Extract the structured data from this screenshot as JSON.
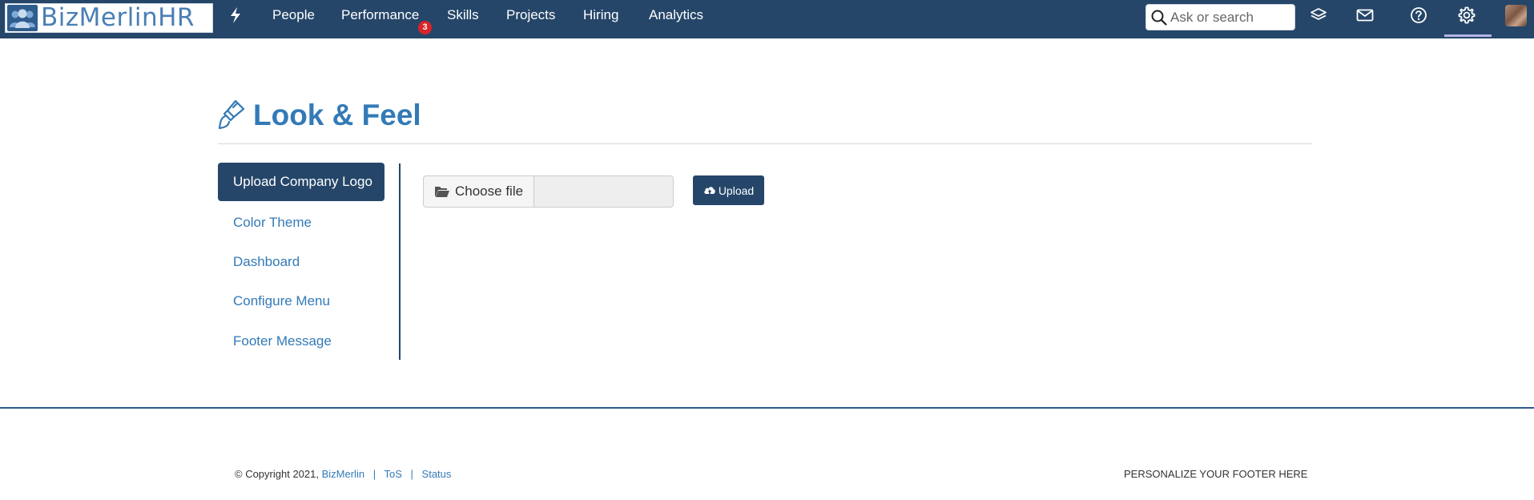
{
  "navbar": {
    "brand": "BizMerlinHR",
    "items": [
      {
        "label": "People"
      },
      {
        "label": "Performance"
      },
      {
        "label": "Skills"
      },
      {
        "label": "Projects"
      },
      {
        "label": "Hiring"
      },
      {
        "label": "Analytics"
      }
    ],
    "performance_badge": "3",
    "search_placeholder": "Ask or search",
    "icons": [
      "bolt-icon",
      "layers-icon",
      "mail-icon",
      "help-icon",
      "gear-icon"
    ]
  },
  "page": {
    "title": "Look & Feel",
    "title_icon": "paintbrush-icon"
  },
  "sidebar": {
    "active": "Upload Company Logo",
    "items": [
      {
        "label": "Color Theme"
      },
      {
        "label": "Dashboard"
      },
      {
        "label": "Configure Menu"
      },
      {
        "label": "Footer Message"
      }
    ]
  },
  "upload": {
    "choose_label": "Choose file",
    "file_value": "",
    "upload_label": "Upload"
  },
  "footer": {
    "copyright": "© Copyright 2021,",
    "brand_link": "BizMerlin",
    "sep": "|",
    "tos": "ToS",
    "status": "Status",
    "message": "PERSONALIZE YOUR FOOTER HERE"
  },
  "colors": {
    "navbar": "#254669",
    "link": "#337ab7",
    "badge": "#d9242a"
  }
}
